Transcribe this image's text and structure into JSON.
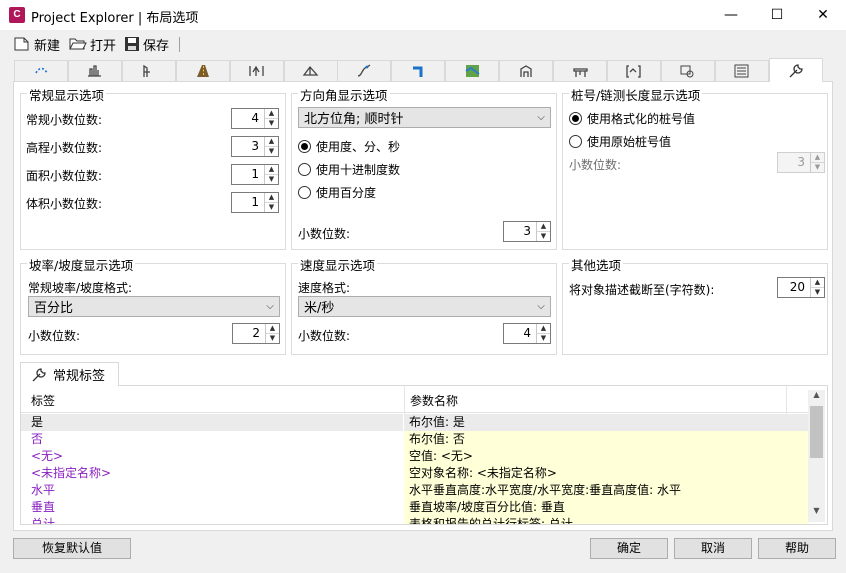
{
  "window": {
    "app_icon_letter": "C",
    "title": "Project Explorer | 布局选项",
    "controls": {
      "minimize": "—",
      "maximize": "☐",
      "close": "✕"
    }
  },
  "toolbar": {
    "new_label": "新建",
    "open_label": "打开",
    "save_label": "保存"
  },
  "tabs": [
    {
      "icon": "alignment-icon"
    },
    {
      "icon": "profile-icon"
    },
    {
      "icon": "profile-view-icon"
    },
    {
      "icon": "corridor-icon"
    },
    {
      "icon": "assembly-icon"
    },
    {
      "icon": "surface-icon"
    },
    {
      "icon": "feature-line-icon"
    },
    {
      "icon": "pipe-network-icon"
    },
    {
      "icon": "map-icon"
    },
    {
      "icon": "structure-icon"
    },
    {
      "icon": "part-icon"
    },
    {
      "icon": "section-icon"
    },
    {
      "icon": "view-frame-icon"
    },
    {
      "icon": "list-icon"
    },
    {
      "icon": "wrench-icon",
      "active": true
    }
  ],
  "general": {
    "title": "常规显示选项",
    "rows": [
      {
        "label": "常规小数位数:",
        "value": "4"
      },
      {
        "label": "高程小数位数:",
        "value": "3"
      },
      {
        "label": "面积小数位数:",
        "value": "1"
      },
      {
        "label": "体积小数位数:",
        "value": "1"
      }
    ]
  },
  "bearing": {
    "title": "方向角显示选项",
    "combo": "北方位角; 顺时针",
    "radios": [
      {
        "label": "使用度、分、秒",
        "checked": true
      },
      {
        "label": "使用十进制度数",
        "checked": false
      },
      {
        "label": "使用百分度",
        "checked": false
      }
    ],
    "decimals_label": "小数位数:",
    "decimals_value": "3"
  },
  "station": {
    "title": "桩号/链测长度显示选项",
    "radios": [
      {
        "label": "使用格式化的桩号值",
        "checked": true
      },
      {
        "label": "使用原始桩号值",
        "checked": false
      }
    ],
    "decimals_label": "小数位数:",
    "decimals_value": "3"
  },
  "grade": {
    "title": "坡率/坡度显示选项",
    "format_label": "常规坡率/坡度格式:",
    "combo": "百分比",
    "decimals_label": "小数位数:",
    "decimals_value": "2"
  },
  "speed": {
    "title": "速度显示选项",
    "format_label": "速度格式:",
    "combo": "米/秒",
    "decimals_label": "小数位数:",
    "decimals_value": "4"
  },
  "other": {
    "title": "其他选项",
    "truncate_label": "将对象描述截断至(字符数):",
    "truncate_value": "20"
  },
  "labels": {
    "tab_label": "常规标签",
    "columns": [
      "标签",
      "参数名称"
    ],
    "rows": [
      {
        "label": "是",
        "param": "布尔值: 是",
        "color": "#000000",
        "selected": true
      },
      {
        "label": "否",
        "param": "布尔值: 否",
        "color": "#8a1fc2"
      },
      {
        "label": "<无>",
        "param": "空值: <无>",
        "color": "#8a1fc2"
      },
      {
        "label": "<未指定名称>",
        "param": "空对象名称: <未指定名称>",
        "color": "#8a1fc2"
      },
      {
        "label": "水平",
        "param": "水平垂直高度:水平宽度/水平宽度:垂直高度值: 水平",
        "color": "#8a1fc2"
      },
      {
        "label": "垂直",
        "param": "垂直坡率/坡度百分比值: 垂直",
        "color": "#8a1fc2"
      },
      {
        "label": "总计",
        "param": "表格和报告的总计行标签: 总计",
        "color": "#8a1fc2"
      }
    ]
  },
  "buttons": {
    "restore": "恢复默认值",
    "ok": "确定",
    "cancel": "取消",
    "help": "帮助"
  }
}
